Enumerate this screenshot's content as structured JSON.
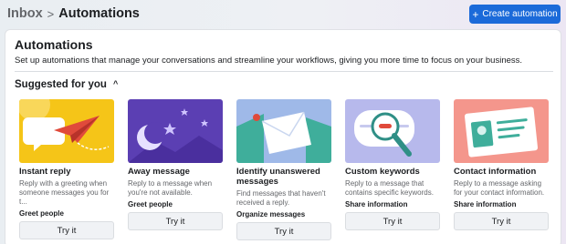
{
  "breadcrumb": {
    "parent": "Inbox",
    "separator": ">",
    "current": "Automations"
  },
  "header": {
    "create_label": "Create automation",
    "create_icon": "plus-icon"
  },
  "panel": {
    "title": "Automations",
    "subtitle": "Set up automations that manage your conversations and streamline your workflows, giving you more time to focus on your business."
  },
  "suggested": {
    "label": "Suggested for you",
    "toggle_icon": "chevron-up-icon"
  },
  "cards": [
    {
      "title": "Instant reply",
      "description": "Reply with a greeting when someone messages you for t...",
      "tag": "Greet people",
      "button": "Try it",
      "image_bg": "#f5c518"
    },
    {
      "title": "Away message",
      "description": "Reply to a message when you're not available.",
      "tag": "Greet people",
      "button": "Try it",
      "image_bg": "#5b3fb3"
    },
    {
      "title": "Identify unanswered messages",
      "description": "Find messages that haven't received a reply.",
      "tag": "Organize messages",
      "button": "Try it",
      "image_bg": "#9fb9e8"
    },
    {
      "title": "Custom keywords",
      "description": "Reply to a message that contains specific keywords.",
      "tag": "Share information",
      "button": "Try it",
      "image_bg": "#b7b9ec"
    },
    {
      "title": "Contact information",
      "description": "Reply to a message asking for your contact information.",
      "tag": "Share information",
      "button": "Try it",
      "image_bg": "#f4968c"
    }
  ],
  "colors": {
    "primary": "#1b6ad9",
    "panel_bg": "#ffffff"
  }
}
